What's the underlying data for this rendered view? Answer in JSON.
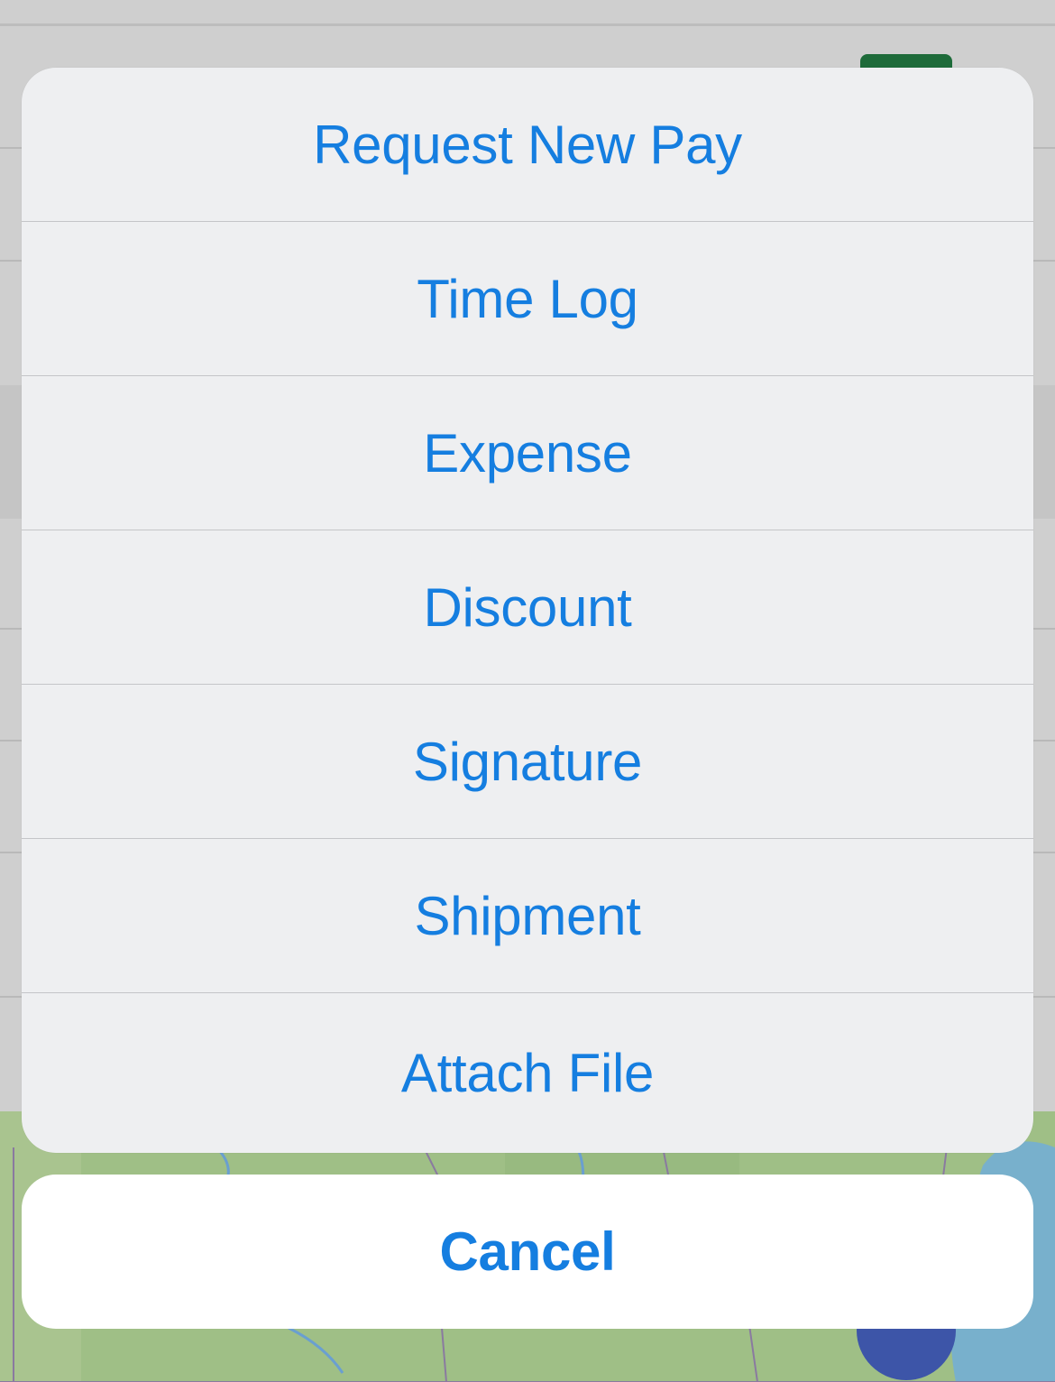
{
  "action_sheet": {
    "items": [
      {
        "label": "Request New Pay"
      },
      {
        "label": "Time Log"
      },
      {
        "label": "Expense"
      },
      {
        "label": "Discount"
      },
      {
        "label": "Signature"
      },
      {
        "label": "Shipment"
      },
      {
        "label": "Attach File"
      }
    ],
    "cancel_label": "Cancel"
  },
  "colors": {
    "action_text": "#157ee0",
    "sheet_background": "#eeeff1",
    "cancel_background": "#ffffff",
    "background_button": "#1e6b3a",
    "map_land": "#9fbf86",
    "map_water": "#78b0cc"
  }
}
